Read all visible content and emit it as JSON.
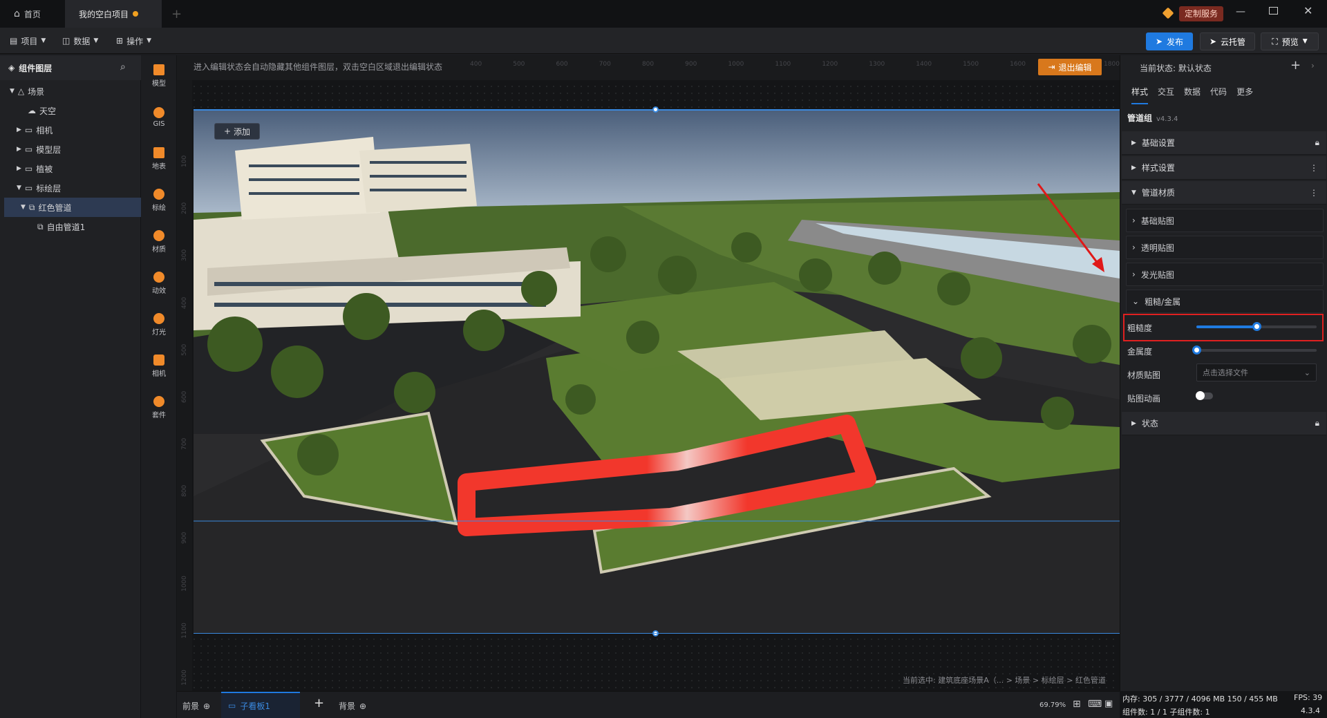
{
  "titlebar": {
    "tabs": [
      {
        "label": "首页"
      },
      {
        "label": "我的空白项目"
      }
    ],
    "custom_service": "定制服务"
  },
  "toolbar": {
    "menus": [
      {
        "label": "项目"
      },
      {
        "label": "数据"
      },
      {
        "label": "操作"
      }
    ],
    "publish": "发布",
    "cloud": "云托管",
    "preview": "预览"
  },
  "layers": {
    "title": "组件图层",
    "items": [
      {
        "label": "场景"
      },
      {
        "label": "天空"
      },
      {
        "label": "相机"
      },
      {
        "label": "模型层"
      },
      {
        "label": "植被"
      },
      {
        "label": "标绘层"
      },
      {
        "label": "红色管道"
      },
      {
        "label": "自由管道1"
      }
    ]
  },
  "iconbar": [
    {
      "label": "模型"
    },
    {
      "label": "GIS"
    },
    {
      "label": "地表"
    },
    {
      "label": "标绘"
    },
    {
      "label": "材质"
    },
    {
      "label": "动效"
    },
    {
      "label": "灯光"
    },
    {
      "label": "相机"
    },
    {
      "label": "套件"
    }
  ],
  "canvas": {
    "hint": "进入编辑状态会自动隐藏其他组件图层，双击空白区域退出编辑状态",
    "exit_edit": "退出编辑",
    "add": "添加",
    "breadcrumb": "当前选中: 建筑底座场景A（... > 场景 > 标绘层 > 红色管道",
    "ruler_top": [
      "400",
      "500",
      "600",
      "700",
      "800",
      "900",
      "1000",
      "1100",
      "1200",
      "1300",
      "1400",
      "1500",
      "1600",
      "1700",
      "1800"
    ],
    "ruler_left": [
      "100",
      "200",
      "300",
      "400",
      "500",
      "600",
      "700",
      "800",
      "900",
      "1000",
      "1100",
      "1200"
    ]
  },
  "panel": {
    "state_label": "当前状态:",
    "state_value": "默认状态",
    "tabs": [
      {
        "label": "样式"
      },
      {
        "label": "交互"
      },
      {
        "label": "数据"
      },
      {
        "label": "代码"
      },
      {
        "label": "更多"
      }
    ],
    "component": "管道组",
    "version": "v4.3.4",
    "sections": {
      "basic": "基础设置",
      "style": "样式设置",
      "material": "管道材质",
      "state": "状态"
    },
    "subs": {
      "base_map": "基础贴图",
      "alpha_map": "透明贴图",
      "emissive_map": "发光贴图",
      "rough_metal": "粗糙/金属"
    },
    "props": {
      "roughness": "粗糙度",
      "roughness_value": 0.5,
      "metalness": "金属度",
      "metalness_value": 0.0,
      "texture": "材质贴图",
      "texture_placeholder": "点击选择文件",
      "anim": "贴图动画"
    }
  },
  "bottombar": {
    "front": "前景",
    "sub": "子看板1",
    "back": "背景",
    "zoom": "69.79%"
  },
  "status": {
    "mem": "内存: 305 / 3777 / 4096 MB 150 / 455 MB",
    "fps": "FPS: 39",
    "counts": "组件数: 1 / 1    子组件数: 1",
    "version": "4.3.4"
  },
  "colors": {
    "accent": "#1f7ae0",
    "orange": "#d8781c",
    "pipe": "#f2372c",
    "highlight": "#e02020"
  }
}
